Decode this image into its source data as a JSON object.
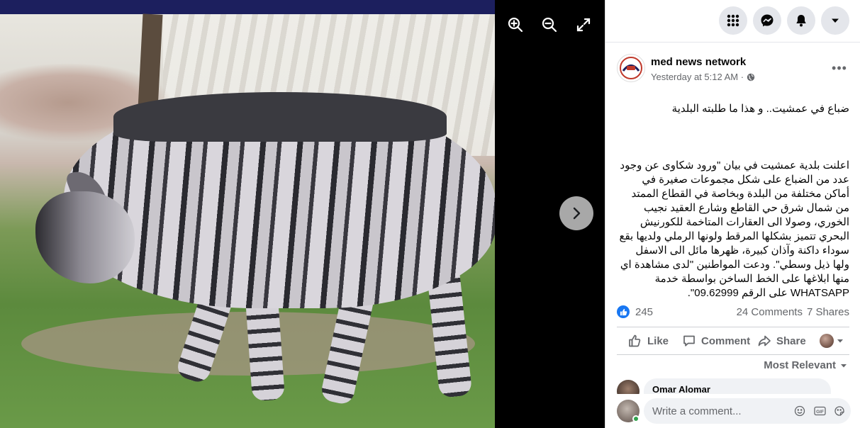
{
  "post": {
    "author": "med news network",
    "timestamp": "Yesterday at 5:12 AM · ",
    "more_label": "•••",
    "headline": "ضباع في عمشيت.. و هذا ما طلبته البلدية",
    "body": "اعلنت بلدية عمشيت في بيان \"ورود شكاوى عن وجود عدد من الضباع على شكل مجموعات صغيرة في أماكن مختلفة من البلدة وبخاصة في القطاع الممتد من شمال شرق حي القاطع وشارع العقيد نجيب الخوري، وصولا الى العقارات المتاخمة للكورنيش البحري تتميز بشكلها المرقط ولونها الرملي ولديها بقع سوداء داكنة وآذان كبيرة، ظهرها مائل الى الاسفل ولها ذيل وسطي\". ودعت المواطنين \"لدى مشاهدة اي منها ابلاغها على الخط الساخن بواسطة خدمة WHATSAPP على الرقم 09.62999\"."
  },
  "stats": {
    "reactions": "245",
    "comments": "24 Comments",
    "shares": "7 Shares"
  },
  "actions": {
    "like": "Like",
    "comment": "Comment",
    "share": "Share"
  },
  "comments": {
    "sort_label": "Most Relevant",
    "first_commenter": "Omar Alomar"
  },
  "composer": {
    "placeholder": "Write a comment..."
  },
  "icons": {
    "zoom_in": "zoom-in-icon",
    "zoom_out": "zoom-out-icon",
    "fullscreen": "fullscreen-icon",
    "next": "chevron-right-icon",
    "menu": "grid-menu-icon",
    "messenger": "messenger-icon",
    "notifications": "bell-icon",
    "account": "caret-down-icon"
  },
  "colors": {
    "accent": "#1877f2",
    "secondary_text": "#65676b",
    "online": "#31a24c"
  }
}
